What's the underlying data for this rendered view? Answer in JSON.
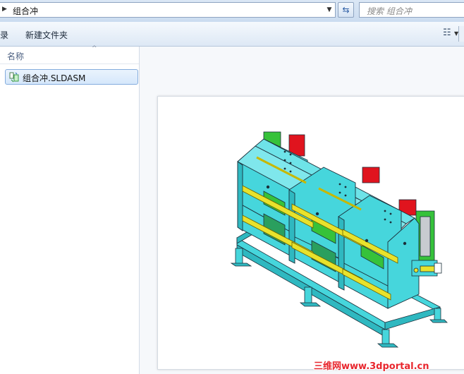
{
  "address": {
    "path": "组合冲"
  },
  "search": {
    "placeholder": "搜索 组合冲"
  },
  "toolbar": {
    "partial_item": "录",
    "new_folder": "新建文件夹"
  },
  "file_list": {
    "column_name": "名称",
    "items": [
      {
        "name": "组合冲.SLDASM",
        "icon": "solidworks-assembly-icon"
      }
    ]
  },
  "preview": {
    "description_icon": "assembly-model-preview"
  },
  "watermark": {
    "text": "三维网www.3dportal.cn"
  },
  "colors": {
    "frame_cyan": "#46d6dc",
    "rail_yellow": "#e8e22c",
    "part_green": "#36c23a",
    "block_red": "#e0141e",
    "watermark_red": "#e8262d"
  }
}
